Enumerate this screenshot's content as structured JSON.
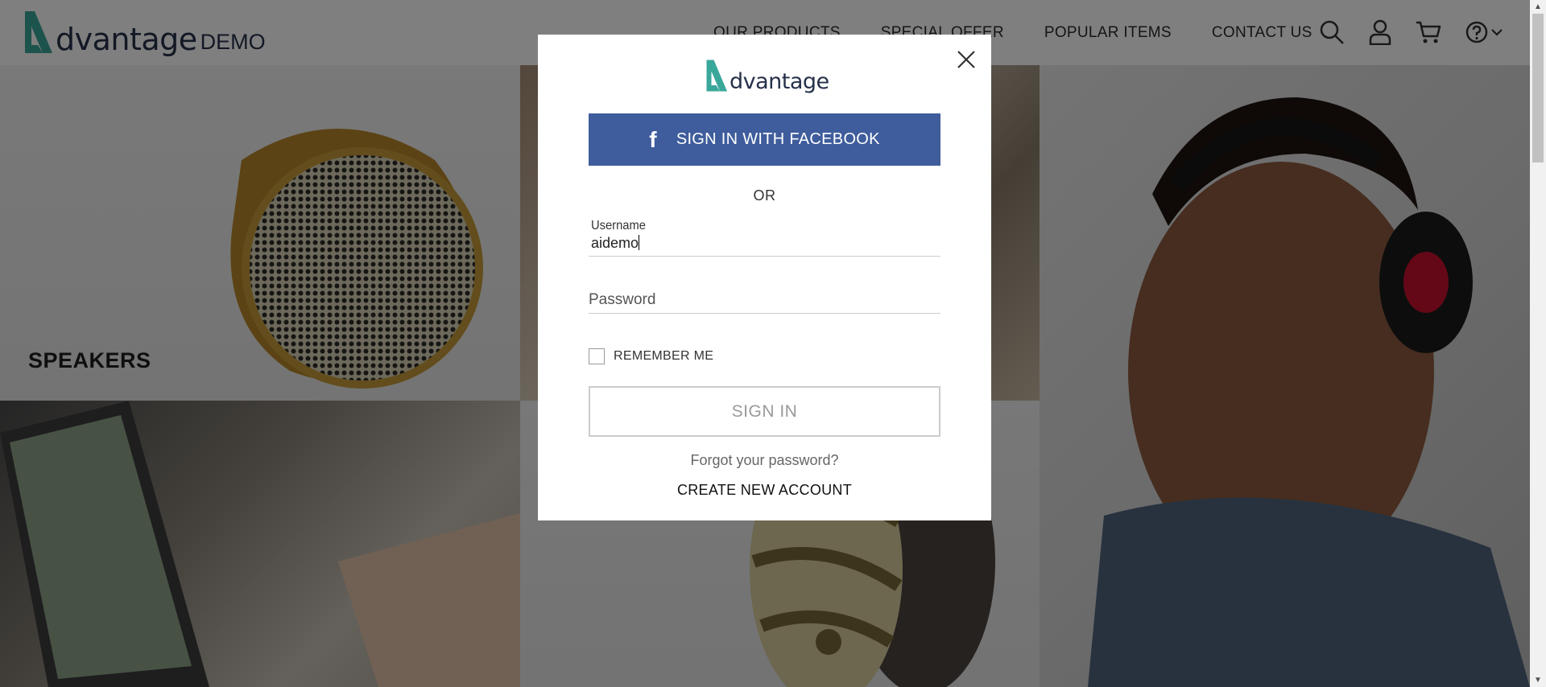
{
  "header": {
    "logo_word": "dvantage",
    "logo_demo": "DEMO",
    "nav": [
      "OUR PRODUCTS",
      "SPECIAL OFFER",
      "POPULAR ITEMS",
      "CONTACT US"
    ],
    "icons": [
      "search-icon",
      "user-icon",
      "cart-icon",
      "help-icon",
      "chevron-down-icon"
    ]
  },
  "tiles": {
    "speakers_label": "SPEAKERS"
  },
  "modal": {
    "logo_word": "dvantage",
    "facebook_label": "SIGN IN WITH FACEBOOK",
    "facebook_icon_char": "f",
    "or_label": "OR",
    "username_label": "Username",
    "username_value": "aidemo",
    "password_placeholder": "Password",
    "remember_label": "REMEMBER ME",
    "remember_checked": false,
    "signin_label": "SIGN IN",
    "forgot_label": "Forgot your password?",
    "create_label": "CREATE NEW ACCOUNT"
  },
  "colors": {
    "brand_teal": "#3aa79b",
    "facebook_blue": "#3f5d9c",
    "logo_text": "#26314a"
  }
}
